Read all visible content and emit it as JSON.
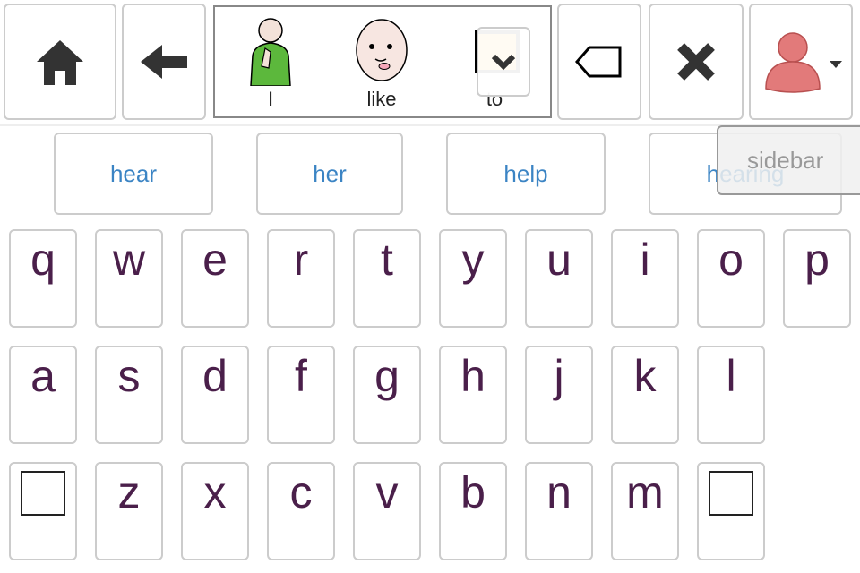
{
  "toolbar": {
    "home_icon": "home-icon",
    "back_icon": "arrow-left-icon",
    "backspace_icon": "backspace-tag-icon",
    "clear_icon": "x-icon",
    "user_icon": "user-avatar-icon",
    "user_menu_caret": "caret-down-icon"
  },
  "message_bar": {
    "symbols": [
      {
        "label": "I",
        "icon": "person-pointing-self-icon"
      },
      {
        "label": "like",
        "icon": "face-licking-lips-icon"
      },
      {
        "label": "to",
        "icon": "orange-square-icon"
      }
    ],
    "expand_icon": "chevron-down-icon"
  },
  "predictions": [
    "hear",
    "her",
    "help",
    "hearing"
  ],
  "sidebar_label": "sidebar",
  "keyboard": {
    "rows": [
      [
        "q",
        "w",
        "e",
        "r",
        "t",
        "y",
        "u",
        "i",
        "o",
        "p"
      ],
      [
        "a",
        "s",
        "d",
        "f",
        "g",
        "h",
        "j",
        "k",
        "l"
      ],
      [
        "",
        "z",
        "x",
        "c",
        "v",
        "b",
        "n",
        "m",
        ""
      ]
    ]
  },
  "colors": {
    "key_text": "#4a1f4a",
    "prediction_text": "#3b84c4",
    "border": "#cccccc"
  }
}
